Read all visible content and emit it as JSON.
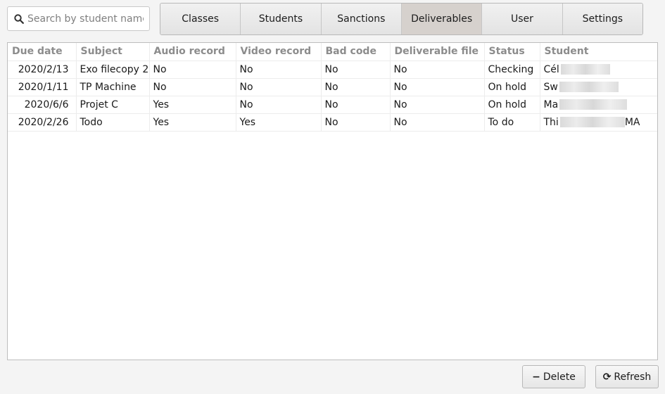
{
  "search": {
    "placeholder": "Search by student name",
    "value": "",
    "icon": "search-icon"
  },
  "tabs": [
    {
      "label": "Classes",
      "active": false
    },
    {
      "label": "Students",
      "active": false
    },
    {
      "label": "Sanctions",
      "active": false
    },
    {
      "label": "Deliverables",
      "active": true
    },
    {
      "label": "User",
      "active": false
    },
    {
      "label": "Settings",
      "active": false
    }
  ],
  "table": {
    "columns": [
      "Due date",
      "Subject",
      "Audio record",
      "Video record",
      "Bad code",
      "Deliverable file",
      "Status",
      "Student"
    ],
    "rows": [
      [
        "2020/2/13",
        "Exo filecopy 2",
        "No",
        "No",
        "No",
        "No",
        "Checking",
        "Cél"
      ],
      [
        "2020/1/11",
        "TP Machine",
        "No",
        "No",
        "No",
        "No",
        "On hold",
        "Sw"
      ],
      [
        "2020/6/6",
        "Projet C",
        "Yes",
        "No",
        "No",
        "No",
        "On hold",
        "Ma"
      ],
      [
        "2020/2/26",
        "Todo",
        "Yes",
        "Yes",
        "No",
        "No",
        "To do",
        "Thi",
        "MA"
      ]
    ]
  },
  "buttons": {
    "delete": {
      "label": "Delete",
      "icon": "minus-icon"
    },
    "refresh": {
      "label": "Refresh",
      "icon": "refresh-icon"
    }
  },
  "colors": {
    "active_tab": "#d6d1cd",
    "header_text": "#8c8c8c"
  }
}
